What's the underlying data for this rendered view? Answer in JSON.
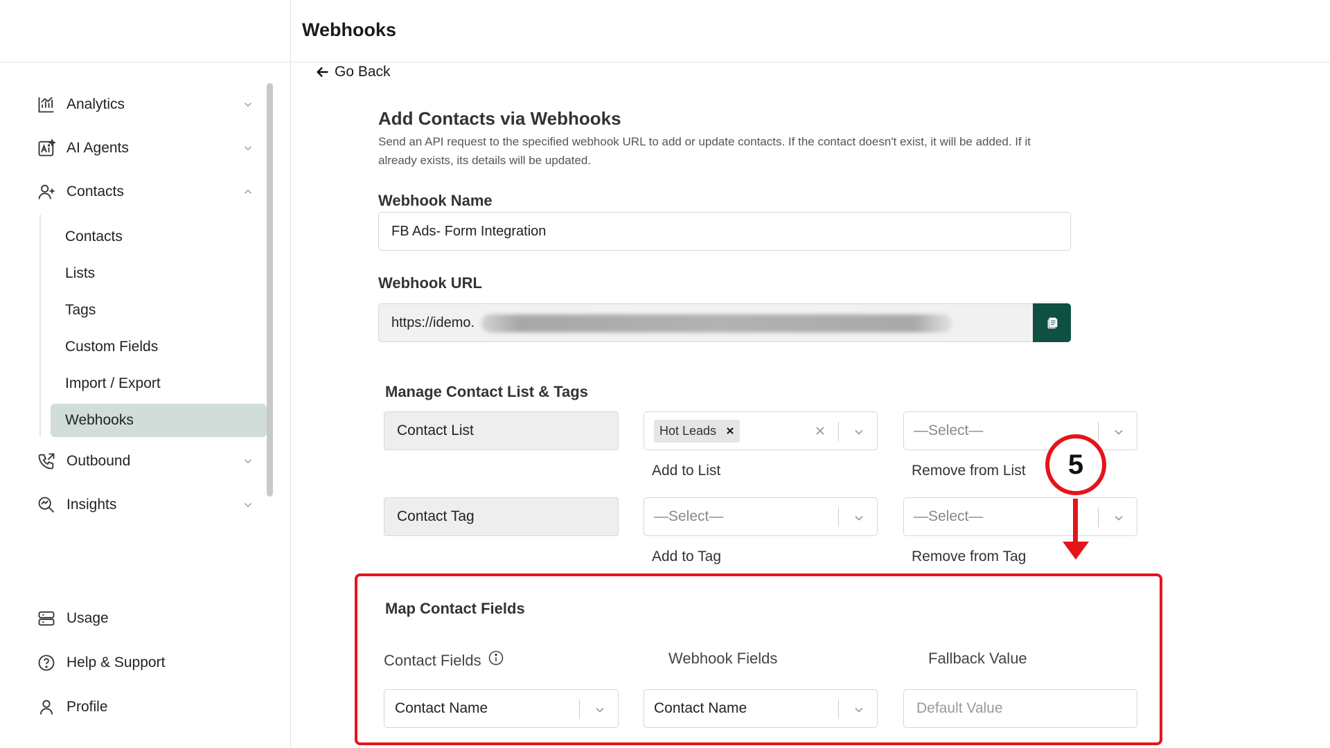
{
  "header": {
    "title": "Webhooks"
  },
  "sidebar": {
    "items": [
      {
        "label": "Analytics",
        "icon": "chart-icon"
      },
      {
        "label": "AI Agents",
        "icon": "ai-icon"
      },
      {
        "label": "Contacts",
        "icon": "user-plus-icon"
      },
      {
        "label": "Outbound",
        "icon": "phone-out-icon"
      },
      {
        "label": "Insights",
        "icon": "insights-icon"
      },
      {
        "label": "Usage",
        "icon": "server-icon"
      },
      {
        "label": "Help & Support",
        "icon": "help-icon"
      },
      {
        "label": "Profile",
        "icon": "user-icon"
      }
    ],
    "sub_items": [
      "Contacts",
      "Lists",
      "Tags",
      "Custom Fields",
      "Import / Export",
      "Webhooks"
    ],
    "active_sub_item": "Webhooks"
  },
  "page": {
    "go_back": "Go Back",
    "title": "Add Contacts via Webhooks",
    "description": "Send an API request to the specified webhook URL to add or update contacts. If the contact doesn't exist, it will be added. If it already exists, its details will be updated.",
    "webhook_name_label": "Webhook Name",
    "webhook_name_value": "FB Ads- Form Integration",
    "webhook_url_label": "Webhook URL",
    "webhook_url_value": "https://idemo.",
    "manage_heading": "Manage Contact List & Tags",
    "contact_list_label": "Contact List",
    "contact_tag_label": "Contact Tag",
    "hot_leads_tag": "Hot Leads",
    "select_placeholder": "—Select—",
    "add_to_list": "Add to List",
    "remove_from_list": "Remove from List",
    "add_to_tag": "Add to Tag",
    "remove_from_tag": "Remove from Tag",
    "map_heading": "Map Contact Fields",
    "col_contact_fields": "Contact Fields",
    "col_webhook_fields": "Webhook Fields",
    "col_fallback": "Fallback Value",
    "contact_field_value": "Contact Name",
    "webhook_field_value": "Contact Name",
    "fallback_placeholder": "Default Value",
    "step_number": "5"
  },
  "colors": {
    "accent": "#0e5143",
    "active_bg": "#d0ddd8",
    "annotation": "#e5141a"
  }
}
